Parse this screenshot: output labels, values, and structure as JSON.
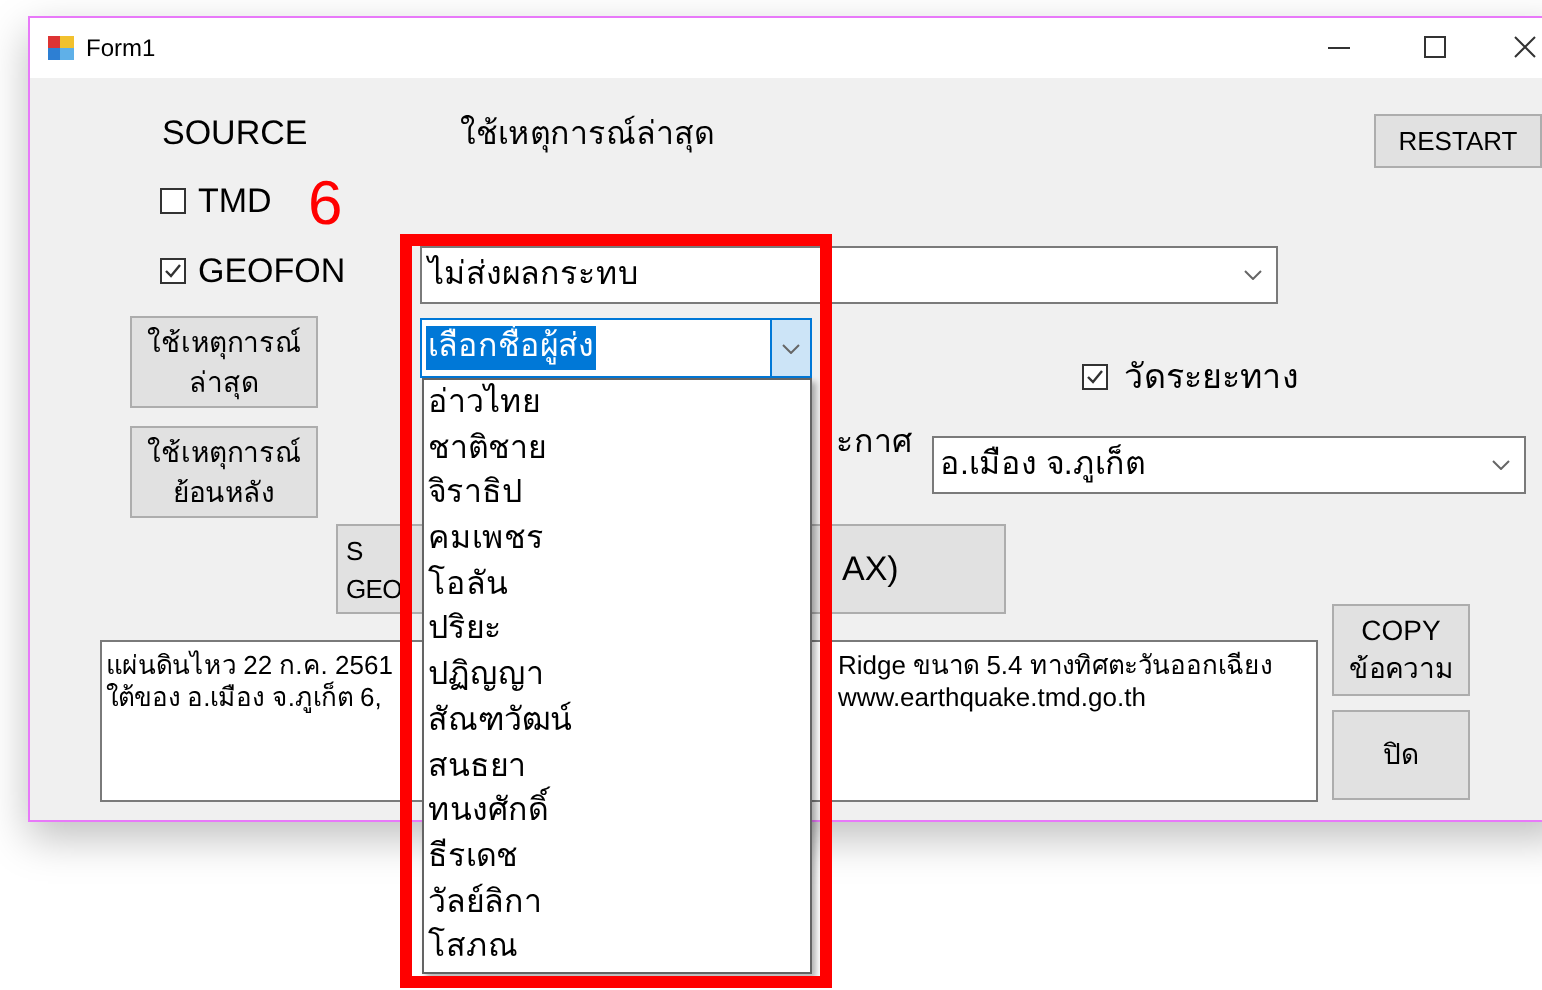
{
  "window": {
    "title": "Form1"
  },
  "source_label": "SOURCE",
  "latest_label": "ใช้เหตุการณ์ล่าสุด",
  "restart_button": "RESTART",
  "checkboxes": [
    {
      "label": "TMD",
      "checked": false
    },
    {
      "label": "GEOFON",
      "checked": true
    }
  ],
  "annotation": "6",
  "impact_combo": {
    "value": "ไม่ส่งผลกระทบ"
  },
  "side_buttons": [
    {
      "lines": [
        "ใช้เหตุการณ์",
        "ล่าสุด"
      ]
    },
    {
      "lines": [
        "ใช้เหตุการณ์",
        "ย้อนหลัง"
      ]
    }
  ],
  "sender_combo": {
    "value": "เลือกชื่อผู้ส่ง",
    "expanded": true,
    "options": [
      {
        "label": "อ่าวไทย",
        "selected": false
      },
      {
        "label": "ชาติชาย",
        "selected": false
      },
      {
        "label": "จิราธิป",
        "selected": false
      },
      {
        "label": "คมเพชร",
        "selected": false
      },
      {
        "label": "โอลัน",
        "selected": false
      },
      {
        "label": "ปริยะ",
        "selected": false
      },
      {
        "label": "ปฏิญญา",
        "selected": false
      },
      {
        "label": "สัณฑวัฒน์",
        "selected": false
      },
      {
        "label": "สนธยา",
        "selected": false
      },
      {
        "label": "ทนงศักดิ์",
        "selected": false
      },
      {
        "label": "ธีรเดช",
        "selected": false
      },
      {
        "label": "วัลย์ลิกา",
        "selected": false
      },
      {
        "label": "โสภณ",
        "selected": false
      }
    ]
  },
  "distance_checkbox": {
    "label": "วัดระยะทาง",
    "checked": true
  },
  "location_label": "ะกาศ",
  "location_combo": {
    "value": "อ.เมือง จ.ภูเก็ต"
  },
  "wide_buttons": [
    {
      "lines": [
        "S",
        "GEO"
      ]
    },
    {
      "lines": [
        "AX)"
      ]
    }
  ],
  "message_box": {
    "lines": [
      {
        "left": "แผ่นดินไหว 22 ก.ค. 2561",
        "right": "Ridge ขนาด 5.4 ทางทิศตะวันออกเฉียง"
      },
      {
        "left": "ใต้ของ อ.เมือง จ.ภูเก็ต 6,",
        "right": "www.earthquake.tmd.go.th"
      }
    ]
  },
  "copy_button": {
    "lines": [
      "COPY",
      "ข้อความ"
    ]
  },
  "close_button": "ปิด"
}
